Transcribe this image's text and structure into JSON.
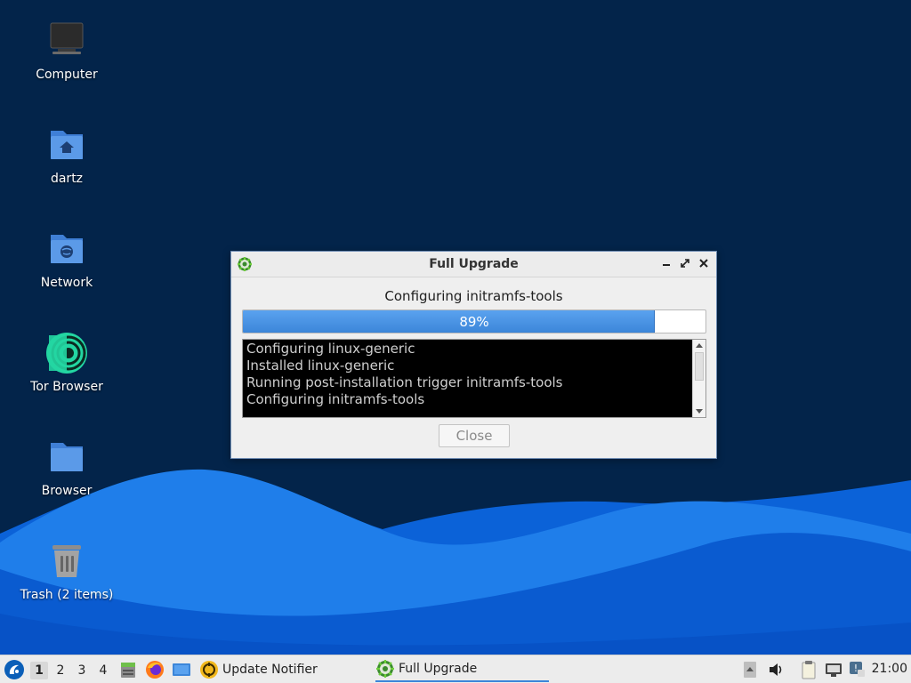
{
  "desktop": {
    "icons": [
      {
        "label": "Computer",
        "icon": "computer-icon"
      },
      {
        "label": "dartz",
        "icon": "home-folder-icon"
      },
      {
        "label": "Network",
        "icon": "network-folder-icon"
      },
      {
        "label": "Tor Browser",
        "icon": "tor-browser-icon"
      },
      {
        "label": "Browser",
        "icon": "folder-icon"
      },
      {
        "label": "Trash (2 items)",
        "icon": "trash-icon"
      }
    ]
  },
  "dialog": {
    "title": "Full Upgrade",
    "status": "Configuring initramfs-tools",
    "progress_percent": 89,
    "progress_label": "89%",
    "log_lines": [
      "Configuring linux-generic",
      "Installed linux-generic",
      "Running post-installation trigger initramfs-tools",
      "Configuring initramfs-tools"
    ],
    "close_label": "Close"
  },
  "taskbar": {
    "workspaces": [
      "1",
      "2",
      "3",
      "4"
    ],
    "active_workspace": "1",
    "tasks": [
      {
        "label": "Update Notifier",
        "icon": "update-notifier-icon"
      },
      {
        "label": "Full Upgrade",
        "icon": "gear-icon"
      }
    ],
    "clock": "21:00"
  },
  "colors": {
    "wallpaper": "#03244a",
    "wave_light": "#2b8cf2",
    "wave_dark": "#0a5dd6",
    "accent": "#3c86d9"
  }
}
